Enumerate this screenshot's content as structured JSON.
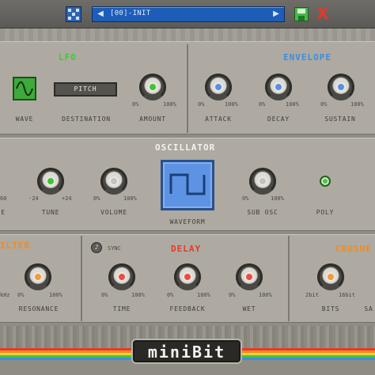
{
  "header": {
    "preset_name": "[00]-INIT",
    "prev_arrow": "◀",
    "next_arrow": "▶",
    "close_glyph": "X"
  },
  "lfo": {
    "title": "LFO",
    "wave_label": "WAVE",
    "destination_label": "DESTINATION",
    "destination_value": "PITCH",
    "amount_label": "AMOUNT",
    "amount_min": "0%",
    "amount_max": "100%"
  },
  "envelope": {
    "title": "ENVELOPE",
    "attack_label": "ATTACK",
    "decay_label": "DECAY",
    "sustain_label": "SUSTAIN",
    "attack_min": "0%",
    "attack_max": "100%",
    "decay_min": "0%",
    "decay_max": "100%",
    "sustain_min": "0%",
    "sustain_max": "100%"
  },
  "oscillator": {
    "title": "OSCILLATOR",
    "left_cut_scale": "60",
    "left_cut_label": "E",
    "tune_label": "TUNE",
    "tune_min": "-24",
    "tune_max": "+24",
    "volume_label": "VOLUME",
    "volume_min": "0%",
    "volume_max": "100%",
    "waveform_label": "WAVEFORM",
    "sub_osc_label": "SUB OSC",
    "sub_osc_min": "0%",
    "sub_osc_max": "100%",
    "poly_label": "POLY"
  },
  "filter": {
    "title": "ILTER",
    "resonance_label": "RESONANCE",
    "left_scale": "kHz",
    "res_min": "0%",
    "res_max": "100%"
  },
  "delay": {
    "title": "DELAY",
    "sync_label": "SYNC",
    "time_label": "TIME",
    "feedback_label": "FEEDBACK",
    "wet_label": "WET",
    "time_min": "0%",
    "time_max": "100%",
    "feedback_min": "0%",
    "feedback_max": "100%",
    "wet_min": "0%",
    "wet_max": "100%"
  },
  "crusher": {
    "title": "CRUSHE",
    "bits_label": "BITS",
    "bits_min": "2bit",
    "bits_max": "16bit",
    "cut_label": "SA"
  },
  "footer": {
    "logo_text": "miniBit"
  },
  "colors": {
    "accent_green": "#45c43d",
    "accent_blue": "#3a8de6",
    "accent_orange": "#f28a1e",
    "accent_red": "#e23b2e",
    "panel": "#aeaaa1"
  },
  "icons": {
    "menu": "grid-menu-icon",
    "save": "floppy-disk-icon",
    "close": "close-icon",
    "lfo_wave": "sine-wave-icon",
    "osc_wave": "square-wave-icon",
    "sync": "note-icon"
  }
}
